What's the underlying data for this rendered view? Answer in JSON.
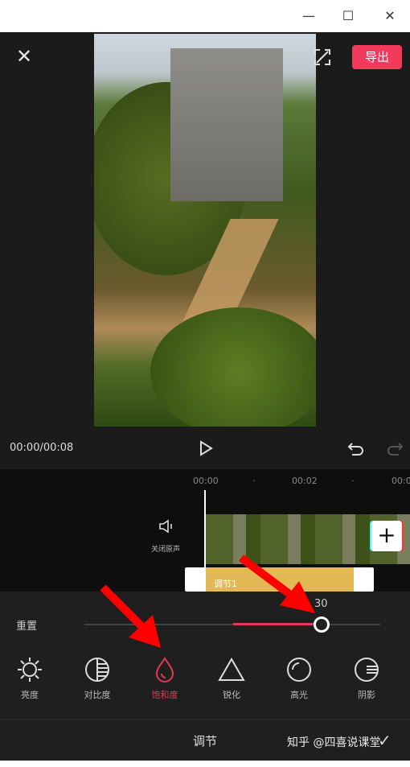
{
  "window": {
    "minimize_icon": "minimize-icon",
    "maximize_icon": "maximize-icon",
    "close_icon": "close-icon"
  },
  "editor": {
    "export_label": "导出",
    "time": "00:00/00:08"
  },
  "timeline": {
    "ticks": [
      "00:00",
      "00:02",
      "00:0"
    ],
    "mute_label": "关闭原声",
    "adjust_clip_label": "调节1",
    "add_label": "+"
  },
  "panel": {
    "reset_label": "重置",
    "slider_value": "30",
    "slider_percent": 30,
    "tools": [
      {
        "label": "亮度",
        "icon": "sun-icon"
      },
      {
        "label": "对比度",
        "icon": "contrast-icon"
      },
      {
        "label": "饱和度",
        "icon": "droplet-icon",
        "active": true
      },
      {
        "label": "锐化",
        "icon": "triangle-icon"
      },
      {
        "label": "高光",
        "icon": "highlight-icon"
      },
      {
        "label": "阴影",
        "icon": "shadow-icon"
      }
    ]
  },
  "bottom": {
    "title": "调节",
    "watermark": "知乎 @四喜说课堂"
  },
  "colors": {
    "accent": "#e5375b",
    "export": "#f23a5d",
    "clip": "#e2b954"
  }
}
